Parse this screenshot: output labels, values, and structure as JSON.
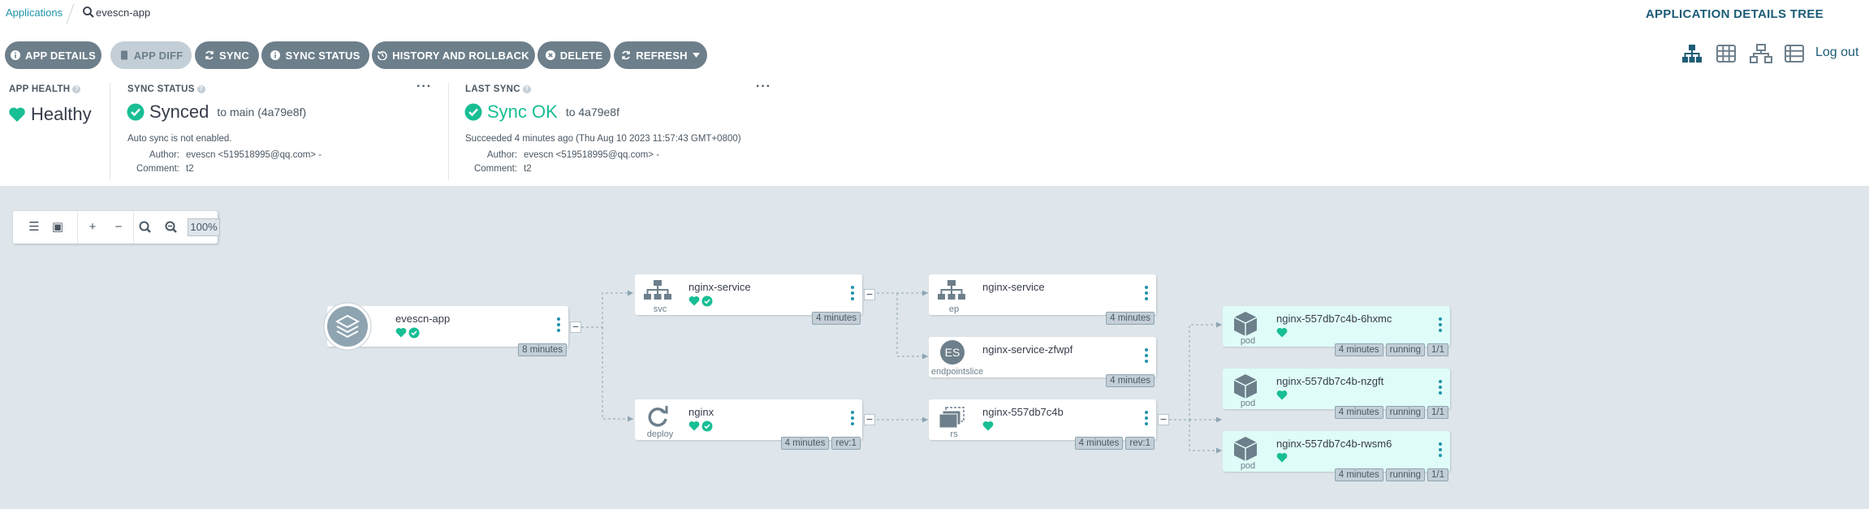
{
  "breadcrumb": {
    "root": "Applications",
    "app": "evescn-app"
  },
  "view_title": "APPLICATION DETAILS TREE",
  "toolbar": {
    "buttons": [
      "APP DETAILS",
      "APP DIFF",
      "SYNC",
      "SYNC STATUS",
      "HISTORY AND ROLLBACK",
      "DELETE",
      "REFRESH"
    ],
    "logout": "Log out"
  },
  "app_health": {
    "title": "APP HEALTH",
    "value": "Healthy"
  },
  "sync_status": {
    "title": "SYNC STATUS",
    "value": "Synced",
    "target": "to main (4a79e8f)",
    "note": "Auto sync is not enabled.",
    "author_label": "Author:",
    "author": "evescn <519518995@qq.com> -",
    "comment_label": "Comment:",
    "comment": "t2"
  },
  "last_sync": {
    "title": "LAST SYNC",
    "value": "Sync OK",
    "target": "to 4a79e8f",
    "detail": "Succeeded 4 minutes ago (Thu Aug 10 2023 11:57:43 GMT+0800)",
    "author_label": "Author:",
    "author": "evescn <519518995@qq.com> -",
    "comment_label": "Comment:",
    "comment": "t2"
  },
  "zoom": {
    "value": "100%"
  },
  "nodes": {
    "app": {
      "name": "evescn-app",
      "tags": [
        "8 minutes"
      ]
    },
    "svc": {
      "name": "nginx-service",
      "kind": "svc",
      "tags": [
        "4 minutes"
      ]
    },
    "deploy": {
      "name": "nginx",
      "kind": "deploy",
      "tags": [
        "4 minutes",
        "rev:1"
      ]
    },
    "ep": {
      "name": "nginx-service",
      "kind": "ep",
      "tags": [
        "4 minutes"
      ]
    },
    "es": {
      "name": "nginx-service-zfwpf",
      "kind": "endpointslice",
      "badge": "ES",
      "tags": [
        "4 minutes"
      ]
    },
    "rs": {
      "name": "nginx-557db7c4b",
      "kind": "rs",
      "tags": [
        "4 minutes",
        "rev:1"
      ]
    },
    "pod1": {
      "name": "nginx-557db7c4b-6hxmc",
      "kind": "pod",
      "tags": [
        "4 minutes",
        "running",
        "1/1"
      ]
    },
    "pod2": {
      "name": "nginx-557db7c4b-nzgft",
      "kind": "pod",
      "tags": [
        "4 minutes",
        "running",
        "1/1"
      ]
    },
    "pod3": {
      "name": "nginx-557db7c4b-rwsm6",
      "kind": "pod",
      "tags": [
        "4 minutes",
        "running",
        "1/1"
      ]
    }
  },
  "colors": {
    "accent": "#1f93ab",
    "healthy": "#18be94",
    "button": "#6d7f8b",
    "pod_bg": "#dffcf8"
  }
}
